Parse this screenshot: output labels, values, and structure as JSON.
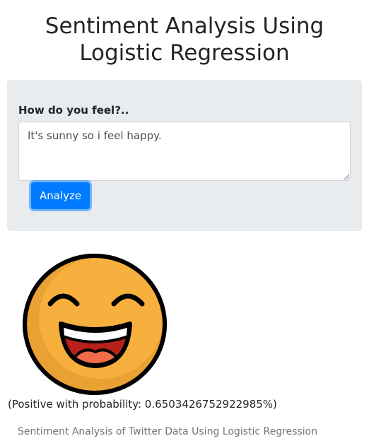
{
  "page": {
    "title_line1": "Sentiment Analysis Using",
    "title_line2": "Logistic Regression"
  },
  "form": {
    "label": "How do you feel?..",
    "input_value": "It's sunny so i feel happy.",
    "button_label": "Analyze"
  },
  "result": {
    "emoji_icon": "happy-face-icon",
    "text": "(Positive with probability: 0.6503426752922985%)"
  },
  "footer": {
    "text": "Sentiment Analysis of Twitter Data Using Logistic Regression"
  },
  "colors": {
    "primary": "#007bff",
    "panel_bg": "#e9ecef",
    "emoji_face": "#f7b03e",
    "emoji_shadow": "#e9a133",
    "emoji_mouth": "#b8201a",
    "emoji_tongue": "#f06c48"
  }
}
